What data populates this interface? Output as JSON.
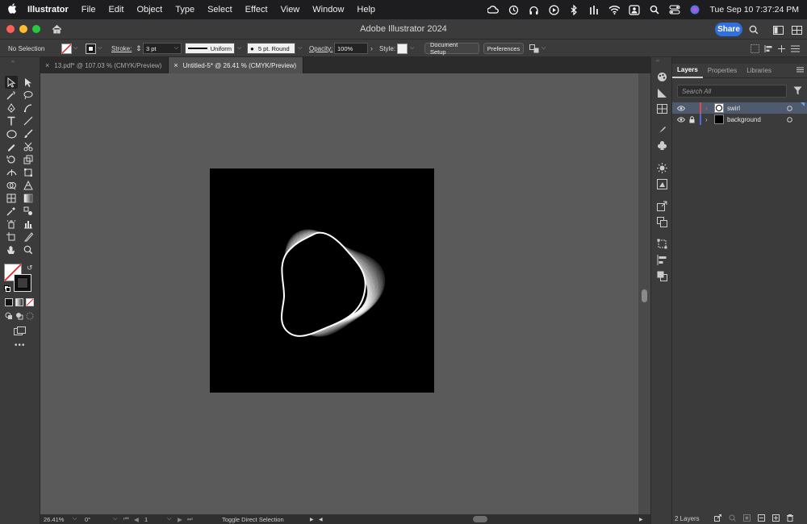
{
  "menubar": {
    "app_name": "Illustrator",
    "items": [
      "File",
      "Edit",
      "Object",
      "Type",
      "Select",
      "Effect",
      "View",
      "Window",
      "Help"
    ],
    "clock": "Tue Sep 10  7:37:24 PM"
  },
  "titlebar": {
    "title": "Adobe Illustrator 2024",
    "share_label": "Share"
  },
  "controlbar": {
    "selection_status": "No Selection",
    "stroke_label": "Stroke:",
    "stroke_weight": "3 pt",
    "profile": "Uniform",
    "brush": "5 pt. Round",
    "opacity_label": "Opacity:",
    "opacity_value": "100%",
    "style_label": "Style:",
    "document_setup_label": "Document Setup",
    "preferences_label": "Preferences"
  },
  "tabs": [
    {
      "label": "13.pdf* @ 107.03 % (CMYK/Preview)",
      "active": false
    },
    {
      "label": "Untitled-5* @ 26.41 % (CMYK/Preview)",
      "active": true
    }
  ],
  "statusbar": {
    "zoom": "26.41%",
    "rotation": "0°",
    "artboard_number": "1",
    "current_tool": "Toggle Direct Selection"
  },
  "layers_panel": {
    "tabs": [
      "Layers",
      "Properties",
      "Libraries"
    ],
    "active_tab": "Layers",
    "search_placeholder": "Search All",
    "layers": [
      {
        "name": "swirl",
        "visible": true,
        "locked": false,
        "color": "#e24a4a",
        "selected": true
      },
      {
        "name": "background",
        "visible": true,
        "locked": true,
        "color": "#4a6ae2",
        "selected": false
      }
    ],
    "layer_count": "2 Layers"
  },
  "colors": {
    "share_blue": "#2f6fe0",
    "traffic_red": "#ff5f57",
    "traffic_yellow": "#febc2e",
    "traffic_green": "#28c840"
  }
}
